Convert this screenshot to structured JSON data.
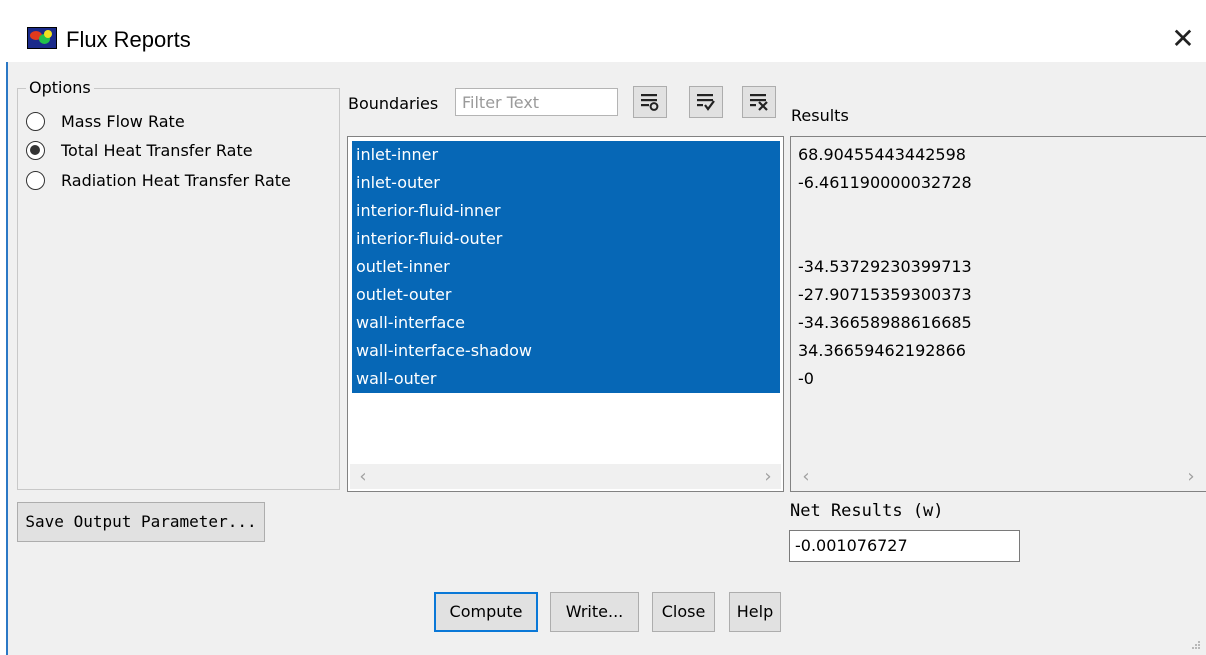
{
  "window": {
    "title": "Flux Reports",
    "close_glyph": "✕",
    "app_icon": "fluent-app-icon"
  },
  "options": {
    "legend": "Options",
    "items": [
      {
        "label": "Mass Flow Rate",
        "checked": false
      },
      {
        "label": "Total Heat Transfer Rate",
        "checked": true
      },
      {
        "label": "Radiation Heat Transfer Rate",
        "checked": false
      }
    ]
  },
  "boundaries": {
    "label": "Boundaries",
    "filter_placeholder": "Filter Text",
    "filter_value": "",
    "toolbar": [
      "select-all-icon",
      "select-checked-icon",
      "deselect-all-icon"
    ],
    "items": [
      "inlet-inner",
      "inlet-outer",
      "interior-fluid-inner",
      "interior-fluid-outer",
      "outlet-inner",
      "outlet-outer",
      "wall-interface",
      "wall-interface-shadow",
      "wall-outer"
    ]
  },
  "results": {
    "label": "Results",
    "rows": [
      "68.90455443442598",
      "-6.461190000032728",
      "",
      "",
      "-34.53729230399713",
      "-27.90715359300373",
      "-34.36658988616685",
      "34.36659462192866",
      "-0"
    ]
  },
  "net": {
    "label": "Net Results (w)",
    "value": "-0.001076727"
  },
  "buttons": {
    "save_output": "Save Output Parameter...",
    "compute": "Compute",
    "write": "Write...",
    "close": "Close",
    "help": "Help"
  },
  "colors": {
    "selection": "#0667b6",
    "default_button_border": "#0a78d7",
    "dialog_bg": "#f0f0f0"
  }
}
